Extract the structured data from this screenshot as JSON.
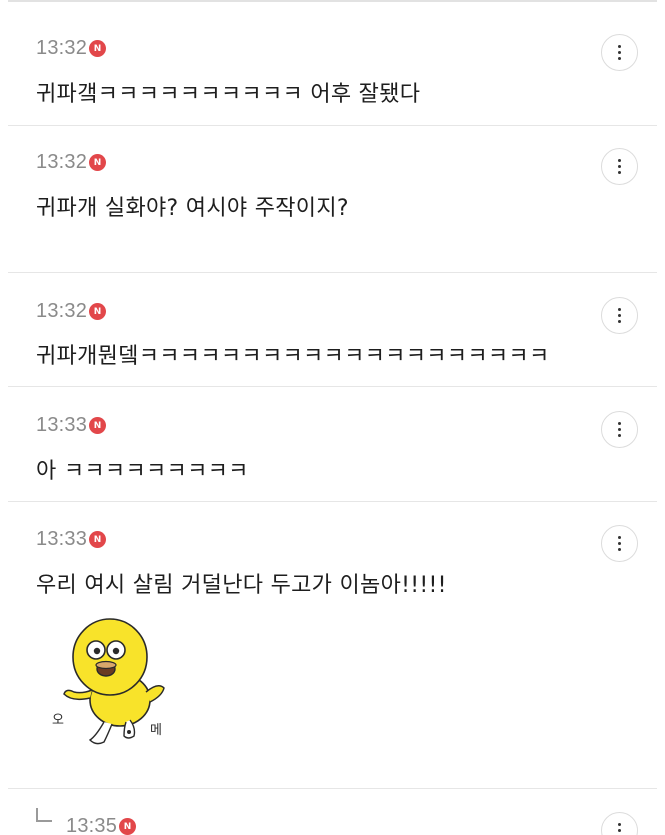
{
  "comments": [
    {
      "time": "13:32",
      "badge": "N",
      "text": "귀파갴ㅋㅋㅋㅋㅋㅋㅋㅋㅋㅋ 어후 잘됐다"
    },
    {
      "time": "13:32",
      "badge": "N",
      "text": "귀파개 실화야? 여시야 주작이지?"
    },
    {
      "time": "13:32",
      "badge": "N",
      "text": "귀파개뭔뎈ㅋㅋㅋㅋㅋㅋㅋㅋㅋㅋㅋㅋㅋㅋㅋㅋㅋㅋㅋㅋ"
    },
    {
      "time": "13:33",
      "badge": "N",
      "text": "아 ㅋㅋㅋㅋㅋㅋㅋㅋㅋ"
    },
    {
      "time": "13:33",
      "badge": "N",
      "text": "우리 여시 살림 거덜난다 두고가 이놈아!!!!!",
      "sticker_text_left": "오",
      "sticker_text_right": "메"
    },
    {
      "time": "13:35",
      "badge": "N"
    }
  ],
  "colors": {
    "badge": "#e2474a",
    "time": "#8a8a8a",
    "sticker": "#f8e32a"
  },
  "icons": {
    "more": "more-vertical-icon",
    "reply": "reply-arrow-icon"
  }
}
